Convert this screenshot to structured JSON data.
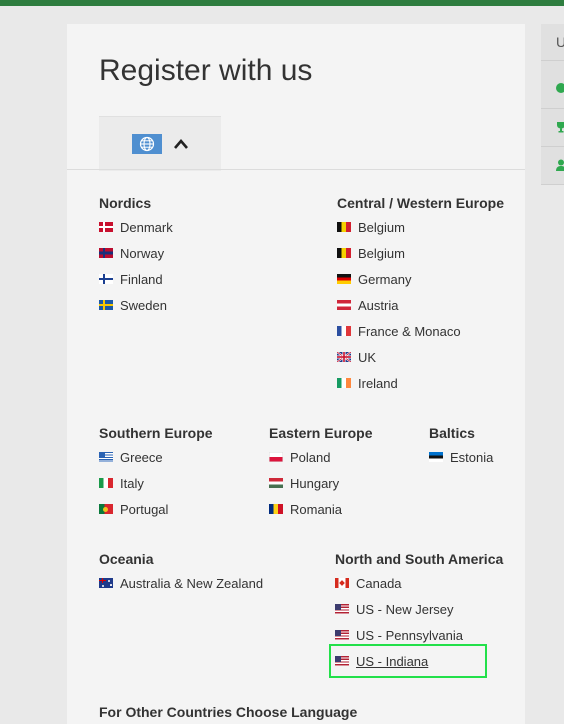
{
  "page": {
    "title": "Register with us"
  },
  "regions": {
    "nordics": {
      "title": "Nordics",
      "items": [
        "Denmark",
        "Norway",
        "Finland",
        "Sweden"
      ]
    },
    "central": {
      "title": "Central / Western Europe",
      "items": [
        "Belgium",
        "Belgium",
        "Germany",
        "Austria",
        "France & Monaco",
        "UK",
        "Ireland"
      ]
    },
    "southern": {
      "title": "Southern Europe",
      "items": [
        "Greece",
        "Italy",
        "Portugal"
      ]
    },
    "eastern": {
      "title": "Eastern Europe",
      "items": [
        "Poland",
        "Hungary",
        "Romania"
      ]
    },
    "baltics": {
      "title": "Baltics",
      "items": [
        "Estonia"
      ]
    },
    "oceania": {
      "title": "Oceania",
      "items": [
        "Australia & New Zealand"
      ]
    },
    "americas": {
      "title": "North and South America",
      "items": [
        "Canada",
        "US - New Jersey",
        "US - Pennsylvania",
        "US - Indiana"
      ]
    }
  },
  "other": {
    "label": "For Other Countries Choose Language"
  },
  "sidebar": {
    "top_letter": "U"
  },
  "colors": {
    "accent": "#2e7d3f",
    "highlight": "#22e04a",
    "globe_bg": "#4f8fd0"
  },
  "icons": {
    "globe": "globe-icon",
    "chevron": "chevron-up-icon"
  }
}
